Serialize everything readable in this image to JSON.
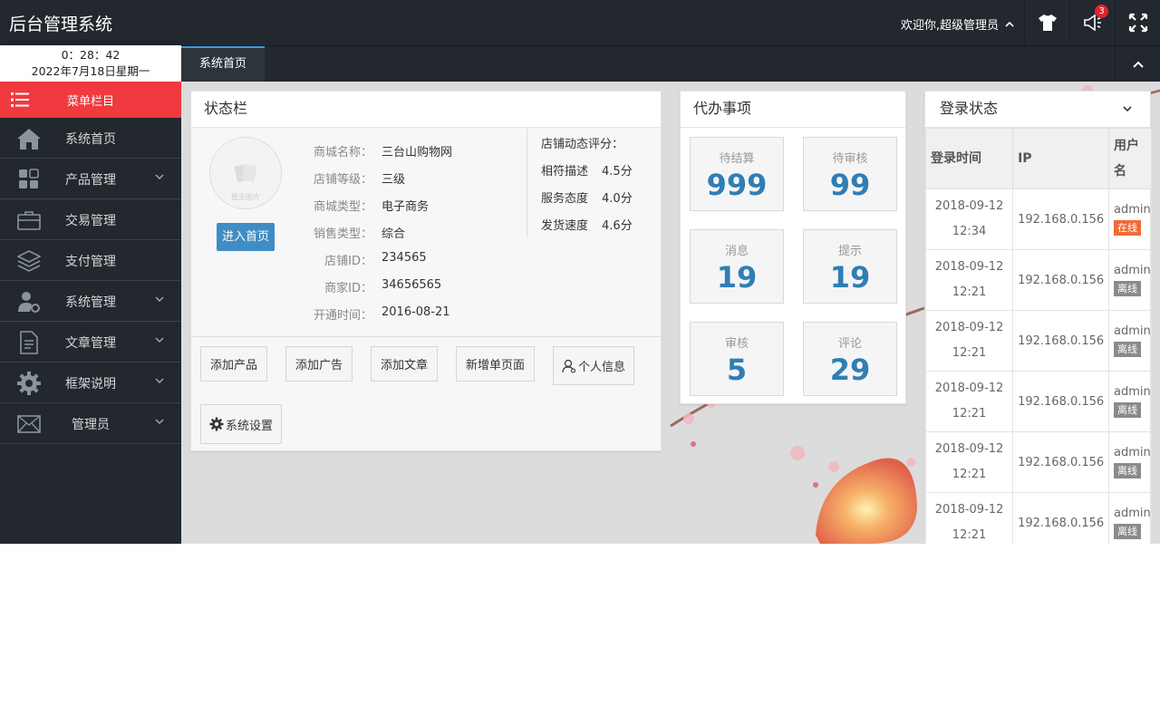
{
  "header": {
    "title": "后台管理系统",
    "welcome": "欢迎你,超级管理员",
    "notification_count": "3"
  },
  "sidebar": {
    "time": "0：28：42",
    "date": "2022年7月18日星期一",
    "menu_title": "菜单栏目",
    "items": [
      {
        "label": "系统首页",
        "icon": "home-icon",
        "expandable": false
      },
      {
        "label": "产品管理",
        "icon": "apps-icon",
        "expandable": true
      },
      {
        "label": "交易管理",
        "icon": "briefcase-icon",
        "expandable": false
      },
      {
        "label": "支付管理",
        "icon": "layers-icon",
        "expandable": false
      },
      {
        "label": "系统管理",
        "icon": "user-gear-icon",
        "expandable": true
      },
      {
        "label": "文章管理",
        "icon": "document-icon",
        "expandable": true
      },
      {
        "label": "框架说明",
        "icon": "gear-icon",
        "expandable": true
      },
      {
        "label": "管理员",
        "icon": "mail-icon",
        "expandable": true
      }
    ]
  },
  "tabs": [
    {
      "label": "系统首页",
      "active": true
    }
  ],
  "status_panel": {
    "title": "状态栏",
    "avatar_caption": "暂无图片",
    "enter_button": "进入首页",
    "info": [
      {
        "key": "商城名称：",
        "value": "三台山购物网"
      },
      {
        "key": "店铺等级：",
        "value": "三级"
      },
      {
        "key": "商城类型：",
        "value": "电子商务"
      },
      {
        "key": "销售类型：",
        "value": "综合"
      },
      {
        "key": "店铺ID：",
        "value": "234565"
      },
      {
        "key": "商家ID：",
        "value": "34656565"
      },
      {
        "key": "开通时间：",
        "value": "2016-08-21"
      }
    ],
    "rating_title": "店铺动态评分：",
    "ratings": [
      {
        "key": "相符描述",
        "value": "4.5分"
      },
      {
        "key": "服务态度",
        "value": "4.0分"
      },
      {
        "key": "发货速度",
        "value": "4.6分"
      }
    ],
    "actions": [
      "添加产品",
      "添加广告",
      "添加文章",
      "新增单页面",
      "个人信息",
      "系统设置"
    ]
  },
  "todo_panel": {
    "title": "代办事项",
    "cards": [
      {
        "label": "待结算",
        "value": "999"
      },
      {
        "label": "待审核",
        "value": "99"
      },
      {
        "label": "消息",
        "value": "19"
      },
      {
        "label": "提示",
        "value": "19"
      },
      {
        "label": "审核",
        "value": "5"
      },
      {
        "label": "评论",
        "value": "29"
      }
    ]
  },
  "login_panel": {
    "title": "登录状态",
    "columns": [
      "登录时间",
      "IP",
      "用户名"
    ],
    "rows": [
      {
        "date": "2018-09-12",
        "time": "12:34",
        "ip": "192.168.0.156",
        "user": "admin",
        "status": "在线",
        "online": true
      },
      {
        "date": "2018-09-12",
        "time": "12:21",
        "ip": "192.168.0.156",
        "user": "admin",
        "status": "离线",
        "online": false
      },
      {
        "date": "2018-09-12",
        "time": "12:21",
        "ip": "192.168.0.156",
        "user": "admin",
        "status": "离线",
        "online": false
      },
      {
        "date": "2018-09-12",
        "time": "12:21",
        "ip": "192.168.0.156",
        "user": "admin",
        "status": "离线",
        "online": false
      },
      {
        "date": "2018-09-12",
        "time": "12:21",
        "ip": "192.168.0.156",
        "user": "admin",
        "status": "离线",
        "online": false
      },
      {
        "date": "2018-09-12",
        "time": "12:21",
        "ip": "192.168.0.156",
        "user": "admin",
        "status": "离线",
        "online": false
      }
    ]
  },
  "colors": {
    "header_bg": "#22282e",
    "menu_accent": "#f13a3f",
    "primary_button": "#3f8dc4",
    "counter_value": "#2f7eb4",
    "online_badge": "#f06b35",
    "offline_badge": "#8a8a8a"
  }
}
